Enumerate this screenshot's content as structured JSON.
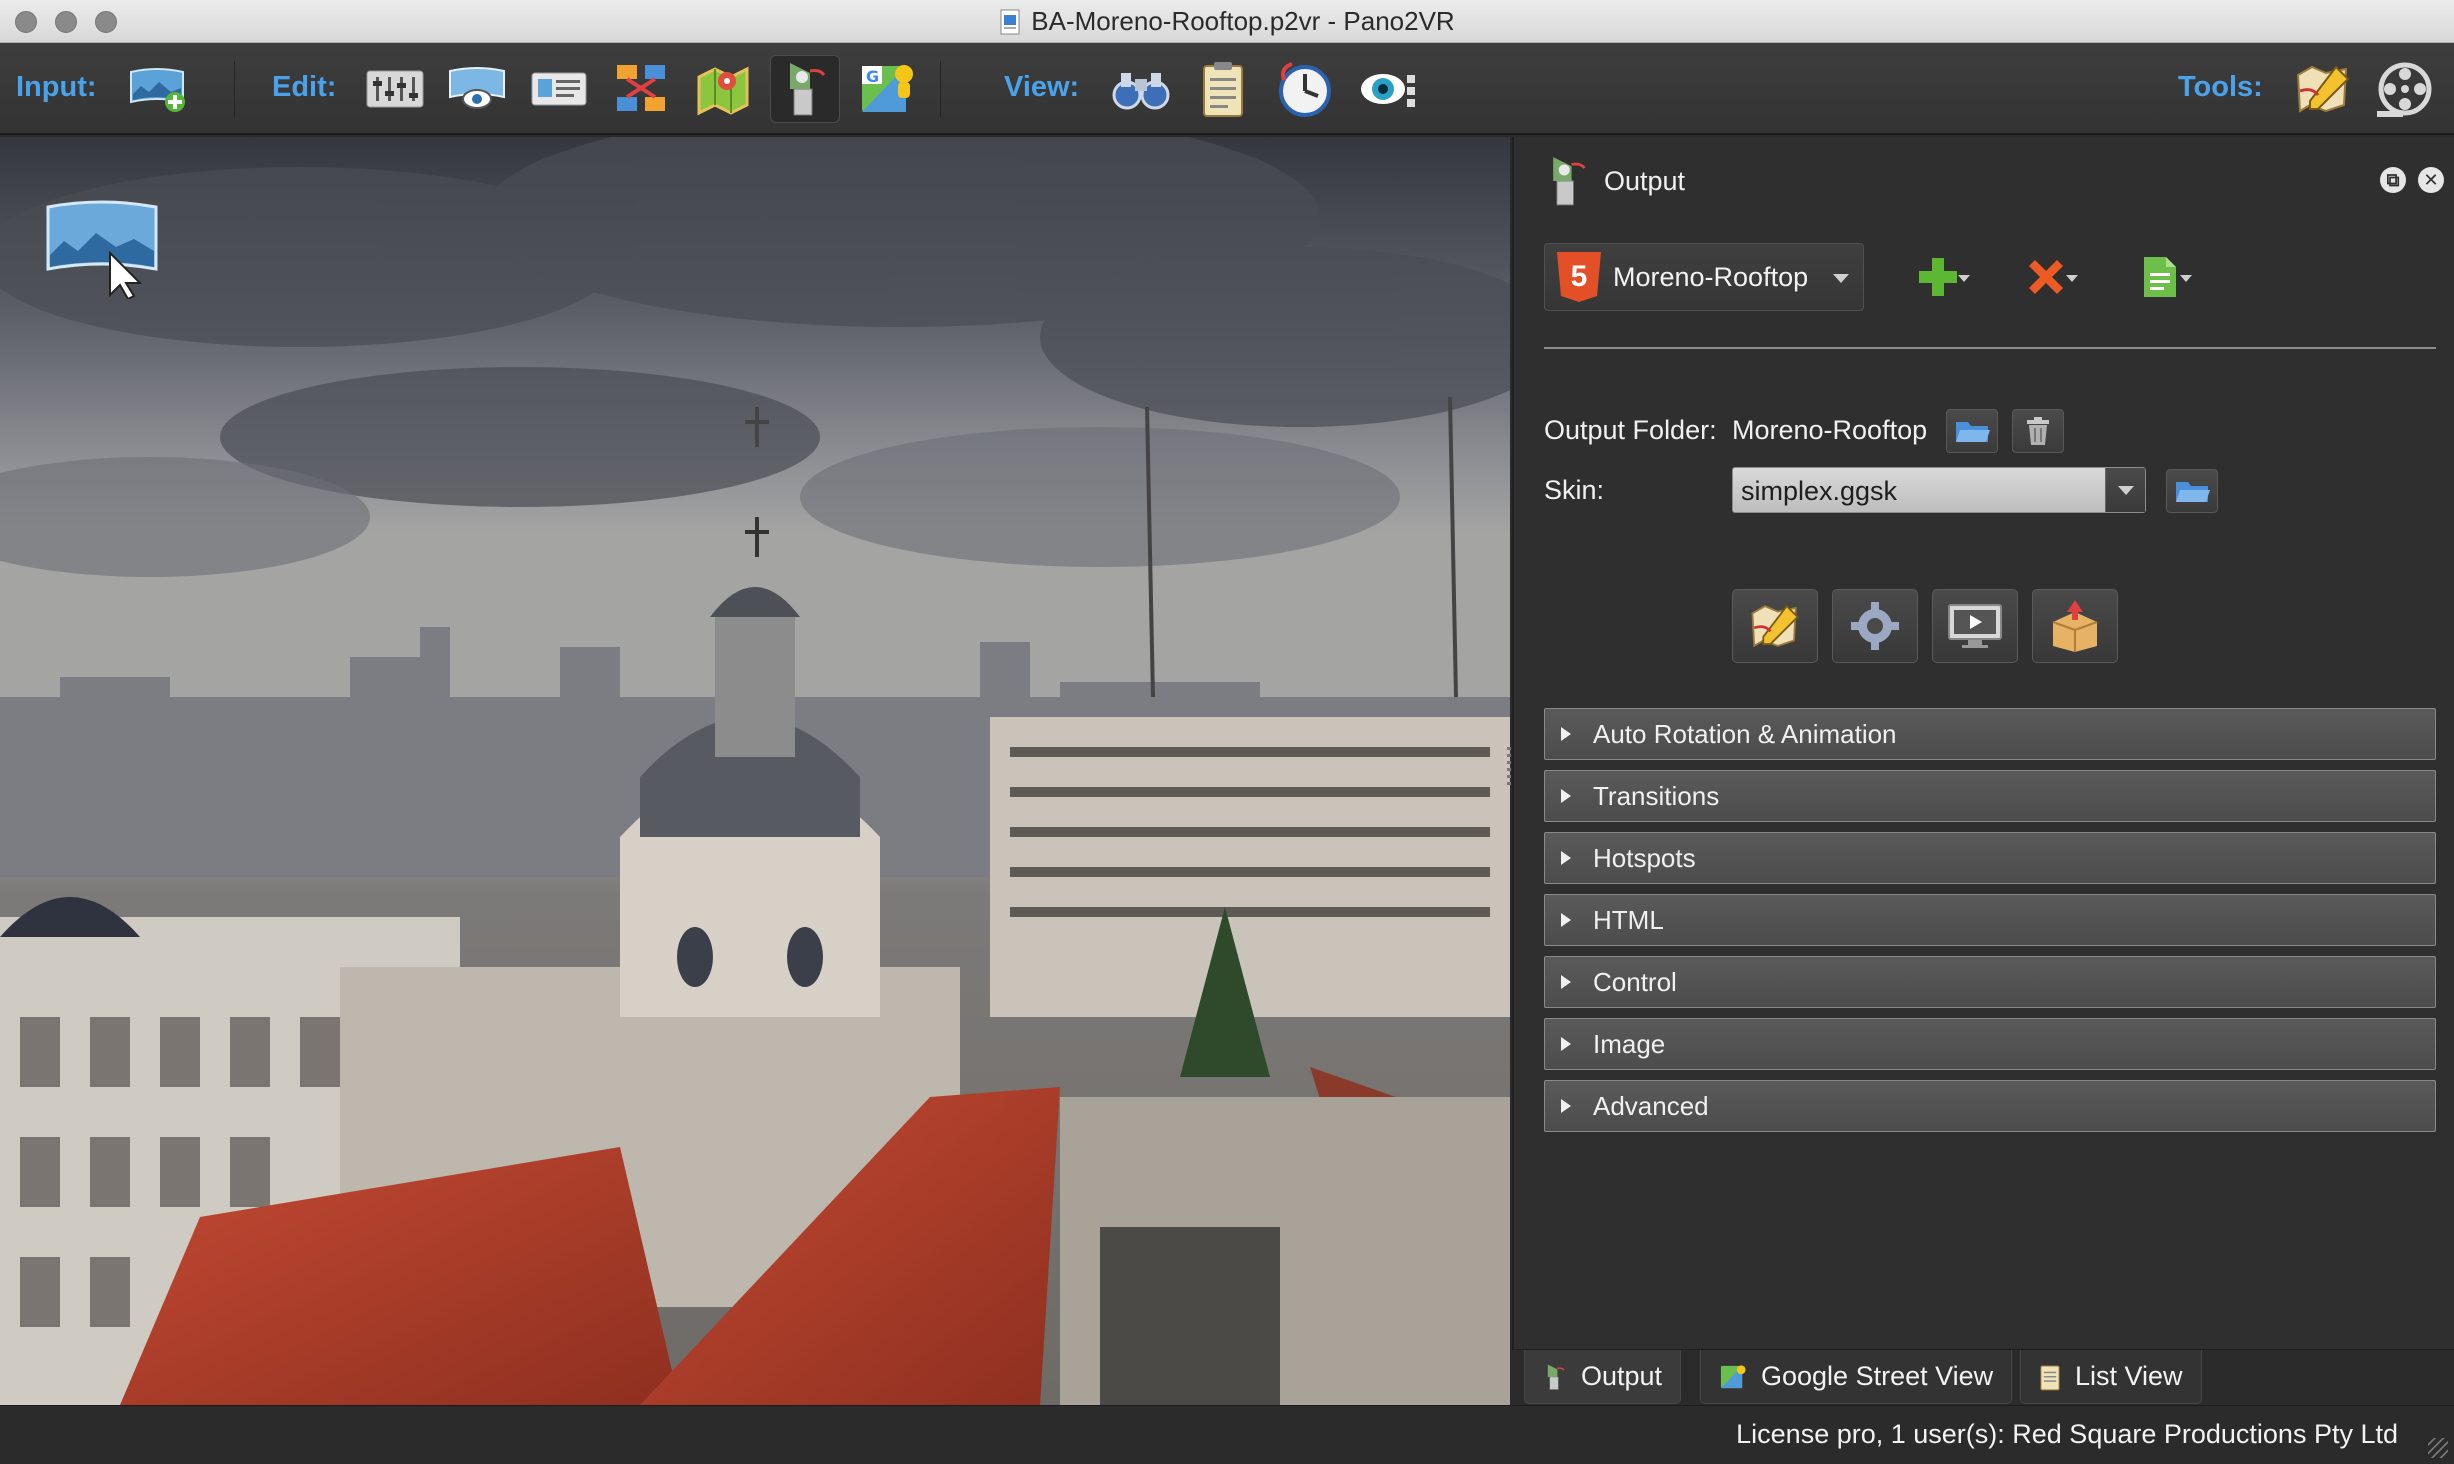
{
  "window": {
    "title": "BA-Moreno-Rooftop.p2vr - Pano2VR"
  },
  "toolbar": {
    "input_label": "Input:",
    "edit_label": "Edit:",
    "view_label": "View:",
    "tools_label": "Tools:",
    "input_buttons": [
      "import-panorama-icon"
    ],
    "edit_buttons": [
      "properties-icon",
      "viewing-parameters-icon",
      "user-data-icon",
      "tour-browser-icon",
      "map-icon",
      "output-icon",
      "street-view-icon"
    ],
    "view_buttons": [
      "binoculars-icon",
      "list-view-icon",
      "tour-icon",
      "eye-icon"
    ],
    "tools_buttons": [
      "skin-editor-icon",
      "animation-icon"
    ],
    "active_button": "output-icon"
  },
  "panel": {
    "title": "Output",
    "preset": {
      "label": "Moreno-Rooftop",
      "icon": "html5-icon"
    },
    "output_folder": {
      "label": "Output Folder:",
      "value": "Moreno-Rooftop"
    },
    "skin": {
      "label": "Skin:",
      "value": "simplex.ggsk"
    },
    "sections": [
      {
        "label": "Auto Rotation & Animation"
      },
      {
        "label": "Transitions"
      },
      {
        "label": "Hotspots"
      },
      {
        "label": "HTML"
      },
      {
        "label": "Control"
      },
      {
        "label": "Image"
      },
      {
        "label": "Advanced"
      }
    ]
  },
  "tabs": [
    {
      "label": "Output",
      "icon": "output-icon",
      "active": true
    },
    {
      "label": "Google Street View",
      "icon": "street-view-icon",
      "active": false
    },
    {
      "label": "List View",
      "icon": "list-view-icon",
      "active": false
    }
  ],
  "status": {
    "license": "License pro, 1 user(s): Red Square Productions Pty Ltd"
  },
  "colors": {
    "accent_label": "#4aa3ea",
    "html5": "#e34f26",
    "add": "#5cb832",
    "delete": "#ee5a24",
    "roof": "#b8402c"
  }
}
